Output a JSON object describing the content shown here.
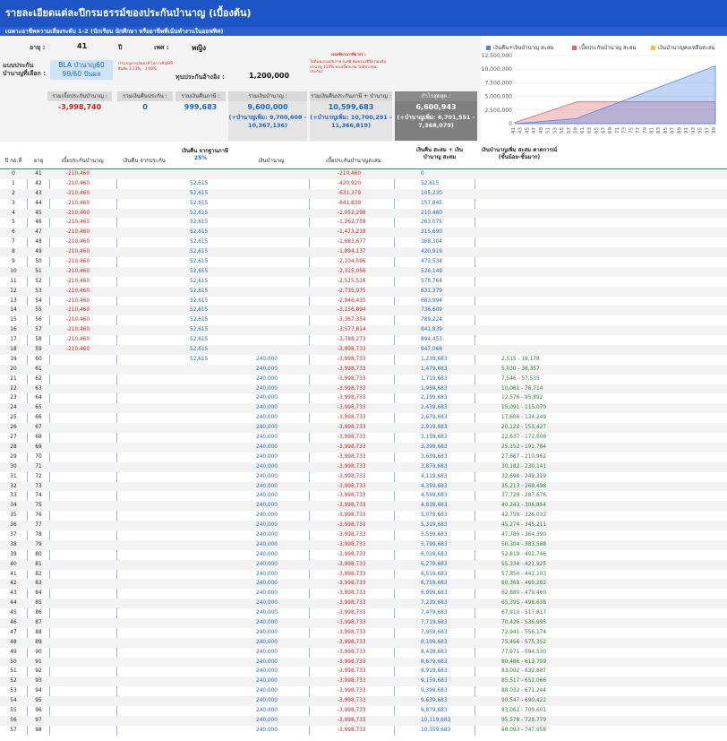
{
  "title": "รายละเอียดแต่ละปีกรมธรรม์ของประกันบำนาญ (เบื้องต้น)",
  "subtitle": "เฉพาะอาชีพความเสี่ยงระดับ 1-2 (นักเรียน นักศึกษา หรืออาชีพที่เน้นทำงานในออฟฟิศ)",
  "form": {
    "age_label": "อายุ :",
    "age": "41",
    "age_unit": "ปี",
    "sex_label": "เพศ :",
    "sex": "หญิง",
    "plan_label": "แบบประกัน บำนาญที่เลือก :",
    "plan_line1": "BLA บำนาญ60",
    "plan_line2": "99/60 ปันผล",
    "plan_note": "บำนาญจากเงินคงที่ ไม่การคืนIRR ยืนยัน 3.23% - 3.49%",
    "sum_label": "ทุนประกันอ้างอิง :",
    "sum": "1,200,000",
    "cond_title": "เงณฑ์ทางภาษีอากร :",
    "cond_text": "ไม่ต้องแถลงสุขภาพ (แต่มี คุ้มครองชีวิต ก่อนรับบำนาญ 110% ของเบี้ยสะสม ไม่มีจากทุนประกัน)"
  },
  "summary": [
    {
      "label": "รวมเบี้ยประกันบำนาญ :",
      "value": "-3,998,740",
      "color": "#d21f1f"
    },
    {
      "label": "รวมเงินคืนประกัน :",
      "value": "0",
      "color": "#1d66c8"
    },
    {
      "label": "รวมเงินคืนภาษี :",
      "value": "999,683",
      "color": "#1d66c8"
    },
    {
      "label": "รวมเงินบำนาญ :",
      "value": "9,600,000",
      "color": "#1d66c8",
      "sub": "(+บำนาญเพิ่ม: 9,700,608 - 10,367,136)"
    },
    {
      "label": "รวมเงินคืนประกันภาษี + บำนาญ :",
      "value": "10,599,683",
      "color": "#1d66c8",
      "sub": "(+บำนาญเพิ่ม: 10,700,291 - 11,366,819)"
    },
    {
      "label": "กำไรสุดสุด :",
      "value": "6,600,943",
      "color": "#ffffff",
      "sub": "(+บำนาญเพิ่ม: 6,701,551 - 7,368,079)"
    }
  ],
  "chart": {
    "legend": [
      {
        "name": "เงินคืน+เงินบำนาญ สะสม",
        "color": "#4a86e8"
      },
      {
        "name": "เบี้ยประกันบำนาญ สะสม",
        "color": "#e06666"
      },
      {
        "name": "เงินบำนาญคงเหลือสะสม",
        "color": "#f1c232"
      }
    ],
    "yticks": [
      "12,500,000",
      "10,000,000",
      "7,500,000",
      "5,000,000",
      "2,500,000",
      "0"
    ],
    "xticks": [
      "41",
      "43",
      "45",
      "47",
      "49",
      "51",
      "53",
      "55",
      "57",
      "59",
      "61",
      "63",
      "65",
      "67",
      "69",
      "71",
      "73",
      "75",
      "77",
      "79",
      "81",
      "83",
      "85",
      "87",
      "89",
      "91",
      "93",
      "95",
      "97",
      "99"
    ]
  },
  "chart_data": {
    "type": "area",
    "x": [
      41,
      45,
      50,
      55,
      59,
      60,
      65,
      70,
      75,
      80,
      85,
      90,
      95,
      99
    ],
    "series": [
      {
        "name": "เงินคืน+เงินบำนาญ สะสม",
        "values": [
          0,
          210460,
          473534,
          736609,
          947068,
          1239683,
          2439683,
          3639683,
          4839683,
          6039683,
          7239683,
          8439683,
          9639683,
          10599683
        ]
      },
      {
        "name": "เบี้ยประกันบำนาญ สะสม",
        "values": [
          210460,
          1052298,
          2104596,
          3156894,
          3998733,
          3998733,
          3998733,
          3998733,
          3998733,
          3998733,
          3998733,
          3998733,
          3998733,
          3998733
        ]
      }
    ],
    "ylim": [
      0,
      12500000
    ]
  },
  "header": {
    "year": "ปี กธ.ที่",
    "age": "อายุ",
    "premium": "เบี้ยประกันบำนาญ",
    "refund_top": "เงินคืน จากฐานภาษี",
    "refund_pct": "25%",
    "refund_ins": "เงินคืน จากประกัน",
    "annuity": "เงินบำนาญ",
    "cum_premium": "เบี้ยประกันบำนาญสะสม",
    "cum_total": "เงินคืน สะสม + เงินบำนาญ สะสม",
    "extra": "เงินบำนาญเพิ่ม สะสม คาดการณ์ (ขั้นน้อย-ขั้นมาก)"
  },
  "rows": [
    [
      "0",
      "41",
      "-210,460",
      "",
      "",
      "-210,460",
      "0",
      ""
    ],
    [
      "1",
      "42",
      "-210,460",
      "52,615",
      "",
      "-420,920",
      "52,615",
      ""
    ],
    [
      "2",
      "43",
      "-210,460",
      "52,615",
      "",
      "-631,379",
      "105,230",
      ""
    ],
    [
      "3",
      "44",
      "-210,460",
      "52,615",
      "",
      "-841,839",
      "157,845",
      ""
    ],
    [
      "4",
      "45",
      "-210,460",
      "52,615",
      "",
      "-1,052,298",
      "210,460",
      ""
    ],
    [
      "5",
      "46",
      "-210,460",
      "52,615",
      "",
      "-1,262,758",
      "263,075",
      ""
    ],
    [
      "6",
      "47",
      "-210,460",
      "52,615",
      "",
      "-1,473,218",
      "315,690",
      ""
    ],
    [
      "7",
      "48",
      "-210,460",
      "52,615",
      "",
      "-1,683,677",
      "368,304",
      ""
    ],
    [
      "8",
      "49",
      "-210,460",
      "52,615",
      "",
      "-1,894,137",
      "420,919",
      ""
    ],
    [
      "9",
      "50",
      "-210,460",
      "52,615",
      "",
      "-2,104,596",
      "473,534",
      ""
    ],
    [
      "10",
      "51",
      "-210,460",
      "52,615",
      "",
      "-2,315,056",
      "526,149",
      ""
    ],
    [
      "11",
      "52",
      "-210,460",
      "52,615",
      "",
      "-2,525,516",
      "578,764",
      ""
    ],
    [
      "12",
      "53",
      "-210,460",
      "52,615",
      "",
      "-2,735,975",
      "631,379",
      ""
    ],
    [
      "13",
      "54",
      "-210,460",
      "52,615",
      "",
      "-2,946,435",
      "683,994",
      ""
    ],
    [
      "14",
      "55",
      "-210,460",
      "52,615",
      "",
      "-3,156,894",
      "736,609",
      ""
    ],
    [
      "15",
      "56",
      "-210,460",
      "52,615",
      "",
      "-3,367,354",
      "789,224",
      ""
    ],
    [
      "16",
      "57",
      "-210,460",
      "52,615",
      "",
      "-3,577,814",
      "841,839",
      ""
    ],
    [
      "17",
      "58",
      "-210,460",
      "52,615",
      "",
      "-3,788,273",
      "894,453",
      ""
    ],
    [
      "18",
      "59",
      "-210,460",
      "52,615",
      "",
      "-3,998,733",
      "947,068",
      ""
    ],
    [
      "19",
      "60",
      "",
      "52,615",
      "240,000",
      "-3,998,733",
      "1,239,683",
      "2,515 - 19,178"
    ],
    [
      "20",
      "61",
      "",
      "",
      "240,000",
      "-3,998,733",
      "1,479,683",
      "5,030 - 38,357"
    ],
    [
      "21",
      "62",
      "",
      "",
      "240,000",
      "-3,998,733",
      "1,719,683",
      "7,546 - 57,535"
    ],
    [
      "22",
      "63",
      "",
      "",
      "240,000",
      "-3,998,733",
      "1,959,683",
      "10,061 - 76,714"
    ],
    [
      "23",
      "64",
      "",
      "",
      "240,000",
      "-3,998,733",
      "2,199,683",
      "12,576 - 95,892"
    ],
    [
      "24",
      "65",
      "",
      "",
      "240,000",
      "-3,998,733",
      "2,439,683",
      "15,091 - 115,070"
    ],
    [
      "25",
      "66",
      "",
      "",
      "240,000",
      "-3,998,733",
      "2,679,683",
      "17,606 - 134,249"
    ],
    [
      "26",
      "67",
      "",
      "",
      "240,000",
      "-3,998,733",
      "2,919,683",
      "20,122 - 153,427"
    ],
    [
      "27",
      "68",
      "",
      "",
      "240,000",
      "-3,998,733",
      "3,159,683",
      "22,637 - 172,606"
    ],
    [
      "28",
      "69",
      "",
      "",
      "240,000",
      "-3,998,733",
      "3,399,683",
      "25,152 - 191,784"
    ],
    [
      "29",
      "70",
      "",
      "",
      "240,000",
      "-3,998,733",
      "3,639,683",
      "27,667 - 210,962"
    ],
    [
      "30",
      "71",
      "",
      "",
      "240,000",
      "-3,998,733",
      "3,879,683",
      "30,182 - 230,141"
    ],
    [
      "31",
      "72",
      "",
      "",
      "240,000",
      "-3,998,733",
      "4,119,683",
      "32,698 - 249,319"
    ],
    [
      "32",
      "73",
      "",
      "",
      "240,000",
      "-3,998,733",
      "4,359,683",
      "35,213 - 268,498"
    ],
    [
      "33",
      "74",
      "",
      "",
      "240,000",
      "-3,998,733",
      "4,599,683",
      "37,728 - 287,676"
    ],
    [
      "34",
      "75",
      "",
      "",
      "240,000",
      "-3,998,733",
      "4,839,683",
      "40,243 - 306,854"
    ],
    [
      "35",
      "76",
      "",
      "",
      "240,000",
      "-3,998,733",
      "5,079,683",
      "42,758 - 326,033"
    ],
    [
      "36",
      "77",
      "",
      "",
      "240,000",
      "-3,998,733",
      "5,319,683",
      "45,274 - 345,211"
    ],
    [
      "37",
      "78",
      "",
      "",
      "240,000",
      "-3,998,733",
      "5,559,683",
      "47,789 - 364,390"
    ],
    [
      "38",
      "79",
      "",
      "",
      "240,000",
      "-3,998,733",
      "5,799,683",
      "50,304 - 383,568"
    ],
    [
      "39",
      "80",
      "",
      "",
      "240,000",
      "-3,998,733",
      "6,039,683",
      "52,819 - 402,746"
    ],
    [
      "40",
      "81",
      "",
      "",
      "240,000",
      "-3,998,733",
      "6,279,683",
      "55,334 - 421,925"
    ],
    [
      "41",
      "82",
      "",
      "",
      "240,000",
      "-3,998,733",
      "6,519,683",
      "57,850 - 441,103"
    ],
    [
      "42",
      "83",
      "",
      "",
      "240,000",
      "-3,998,733",
      "6,759,683",
      "60,365 - 460,282"
    ],
    [
      "43",
      "84",
      "",
      "",
      "240,000",
      "-3,998,733",
      "6,999,683",
      "62,880 - 479,460"
    ],
    [
      "44",
      "85",
      "",
      "",
      "240,000",
      "-3,998,733",
      "7,239,683",
      "65,395 - 498,638"
    ],
    [
      "45",
      "86",
      "",
      "",
      "240,000",
      "-3,998,733",
      "7,479,683",
      "67,910 - 517,817"
    ],
    [
      "46",
      "87",
      "",
      "",
      "240,000",
      "-3,998,733",
      "7,719,683",
      "70,426 - 536,995"
    ],
    [
      "47",
      "88",
      "",
      "",
      "240,000",
      "-3,998,733",
      "7,959,683",
      "72,941 - 556,174"
    ],
    [
      "48",
      "89",
      "",
      "",
      "240,000",
      "-3,998,733",
      "8,199,683",
      "75,456 - 575,352"
    ],
    [
      "49",
      "90",
      "",
      "",
      "240,000",
      "-3,998,733",
      "8,439,683",
      "77,971 - 594,530"
    ],
    [
      "50",
      "91",
      "",
      "",
      "240,000",
      "-3,998,733",
      "8,679,683",
      "80,486 - 613,709"
    ],
    [
      "51",
      "92",
      "",
      "",
      "240,000",
      "-3,998,733",
      "8,919,683",
      "83,002 - 632,887"
    ],
    [
      "52",
      "93",
      "",
      "",
      "240,000",
      "-3,998,733",
      "9,159,683",
      "85,517 - 652,066"
    ],
    [
      "53",
      "94",
      "",
      "",
      "240,000",
      "-3,998,733",
      "9,399,683",
      "88,032 - 671,244"
    ],
    [
      "54",
      "95",
      "",
      "",
      "240,000",
      "-3,998,733",
      "9,639,683",
      "90,547 - 690,422"
    ],
    [
      "55",
      "96",
      "",
      "",
      "240,000",
      "-3,998,733",
      "9,879,683",
      "93,062 - 709,601"
    ],
    [
      "56",
      "97",
      "",
      "",
      "240,000",
      "-3,998,733",
      "10,119,683",
      "95,578 - 728,779"
    ],
    [
      "57",
      "98",
      "",
      "",
      "240,000",
      "-3,998,733",
      "10,359,683",
      "98,093 - 747,958"
    ]
  ]
}
